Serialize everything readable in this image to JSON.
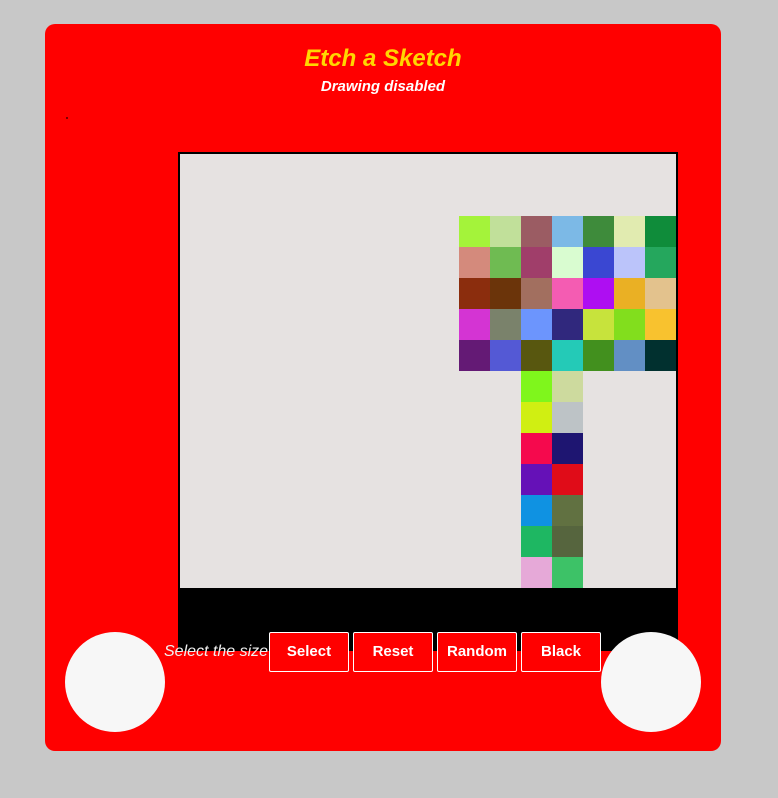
{
  "header": {
    "title": "Etch a Sketch",
    "status": "Drawing disabled"
  },
  "controls": {
    "size_label": "Select the size",
    "select_label": "Select",
    "reset_label": "Reset",
    "random_label": "Random",
    "black_label": "Black"
  },
  "colors": {
    "frame": "#ff0000",
    "title": "#ffd700",
    "screen_background": "#e6e2e1",
    "knob": "#f7f7f7"
  },
  "grid": {
    "cell_count_per_side": 16,
    "painted_cells": [
      {
        "row": 2,
        "col": 9,
        "color": "#a4f33a"
      },
      {
        "row": 2,
        "col": 10,
        "color": "#c1e09a"
      },
      {
        "row": 2,
        "col": 11,
        "color": "#9b5c63"
      },
      {
        "row": 2,
        "col": 12,
        "color": "#7cb9e6"
      },
      {
        "row": 2,
        "col": 13,
        "color": "#3e8b3b"
      },
      {
        "row": 2,
        "col": 14,
        "color": "#e1ebb0"
      },
      {
        "row": 2,
        "col": 15,
        "color": "#0f8c3a"
      },
      {
        "row": 3,
        "col": 9,
        "color": "#d48a7c"
      },
      {
        "row": 3,
        "col": 10,
        "color": "#6fbb52"
      },
      {
        "row": 3,
        "col": 11,
        "color": "#a03e6a"
      },
      {
        "row": 3,
        "col": 12,
        "color": "#d9fcd0"
      },
      {
        "row": 3,
        "col": 13,
        "color": "#3a47d2"
      },
      {
        "row": 3,
        "col": 14,
        "color": "#bbc4fa"
      },
      {
        "row": 3,
        "col": 15,
        "color": "#25a75d"
      },
      {
        "row": 4,
        "col": 9,
        "color": "#8b2d0d"
      },
      {
        "row": 4,
        "col": 10,
        "color": "#6b340a"
      },
      {
        "row": 4,
        "col": 11,
        "color": "#a26f5f"
      },
      {
        "row": 4,
        "col": 12,
        "color": "#f45cb2"
      },
      {
        "row": 4,
        "col": 13,
        "color": "#ae0ef2"
      },
      {
        "row": 4,
        "col": 14,
        "color": "#eab024"
      },
      {
        "row": 4,
        "col": 15,
        "color": "#e3c28d"
      },
      {
        "row": 5,
        "col": 9,
        "color": "#d434d3"
      },
      {
        "row": 5,
        "col": 10,
        "color": "#7a826b"
      },
      {
        "row": 5,
        "col": 11,
        "color": "#6c95fd"
      },
      {
        "row": 5,
        "col": 12,
        "color": "#30287d"
      },
      {
        "row": 5,
        "col": 13,
        "color": "#c7e33c"
      },
      {
        "row": 5,
        "col": 14,
        "color": "#82de1d"
      },
      {
        "row": 5,
        "col": 15,
        "color": "#f8c22f"
      },
      {
        "row": 6,
        "col": 9,
        "color": "#641a75"
      },
      {
        "row": 6,
        "col": 10,
        "color": "#5459d5"
      },
      {
        "row": 6,
        "col": 11,
        "color": "#58570f"
      },
      {
        "row": 6,
        "col": 12,
        "color": "#24cab7"
      },
      {
        "row": 6,
        "col": 13,
        "color": "#42901e"
      },
      {
        "row": 6,
        "col": 14,
        "color": "#628fc4"
      },
      {
        "row": 6,
        "col": 15,
        "color": "#01302f"
      },
      {
        "row": 7,
        "col": 11,
        "color": "#7ff61c"
      },
      {
        "row": 7,
        "col": 12,
        "color": "#cdda9e"
      },
      {
        "row": 8,
        "col": 11,
        "color": "#d0ef12"
      },
      {
        "row": 8,
        "col": 12,
        "color": "#bdc3c6"
      },
      {
        "row": 9,
        "col": 11,
        "color": "#f5094d"
      },
      {
        "row": 9,
        "col": 12,
        "color": "#1e1571"
      },
      {
        "row": 10,
        "col": 11,
        "color": "#6511b7"
      },
      {
        "row": 10,
        "col": 12,
        "color": "#e00c18"
      },
      {
        "row": 11,
        "col": 11,
        "color": "#0f92e2"
      },
      {
        "row": 11,
        "col": 12,
        "color": "#617141"
      },
      {
        "row": 12,
        "col": 11,
        "color": "#1eb762"
      },
      {
        "row": 12,
        "col": 12,
        "color": "#56653e"
      },
      {
        "row": 13,
        "col": 11,
        "color": "#e6a9d8"
      },
      {
        "row": 13,
        "col": 12,
        "color": "#3dc267"
      }
    ]
  }
}
